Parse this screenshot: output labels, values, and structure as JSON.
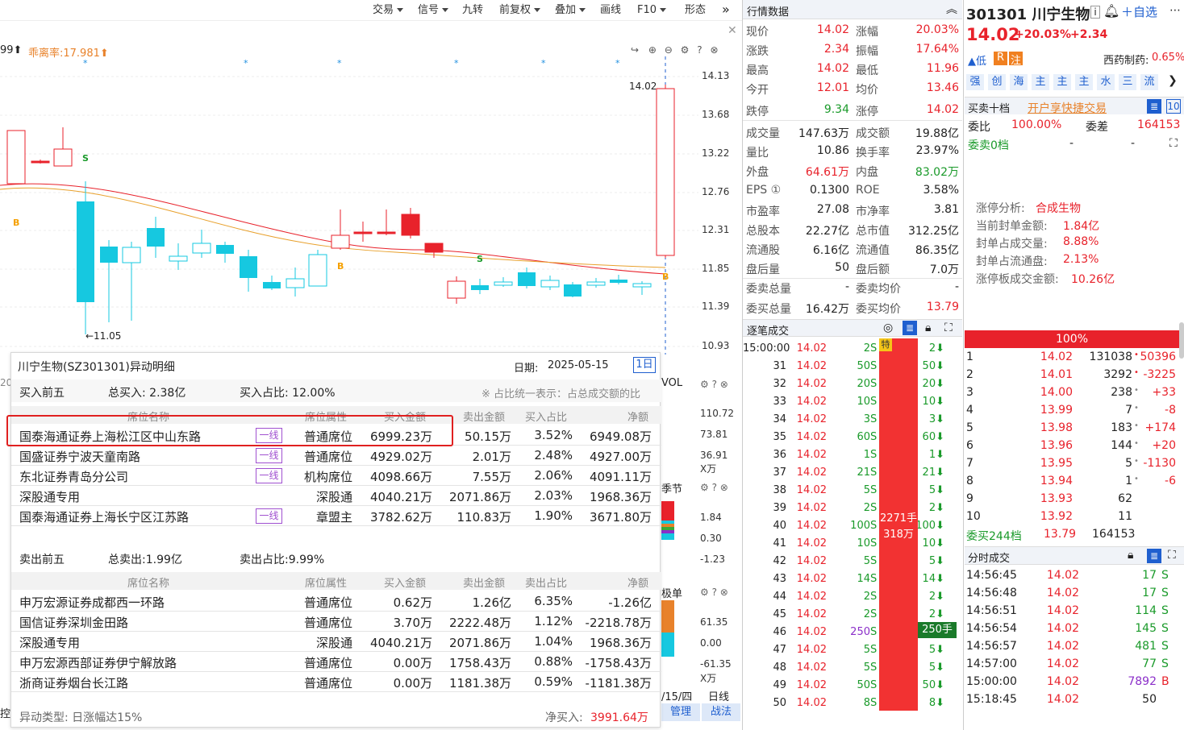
{
  "toolbar": {
    "items": [
      "交易",
      "信号",
      "九转",
      "前复权",
      "叠加",
      "画线",
      "F10",
      "形态"
    ]
  },
  "chart": {
    "indicator_left": "99⬆",
    "deviation_label": "乖离率:17.981⬆",
    "price_axis": [
      "14.13",
      "13.68",
      "13.22",
      "12.76",
      "12.31",
      "11.85",
      "11.39",
      "10.93"
    ],
    "high_mark": "14.02",
    "low_mark": "←11.05",
    "vol_label": "VOL",
    "vol_axis": [
      "110.72",
      "73.81",
      "36.91",
      "X万"
    ],
    "season_label": "季节",
    "season_axis": [
      "1.84",
      "0.30",
      "-1.23"
    ],
    "order_label": "极单",
    "order_axis": [
      "61.35",
      "0.00",
      "-61.35",
      "X万"
    ],
    "date_label": "/15/四",
    "line_label": "日线",
    "manage_label": "管理",
    "battle_label": "战法",
    "left_edge_label": "控",
    "left_edge_label2": "20"
  },
  "popup": {
    "title": "川宁生物(SZ301301)异动明细",
    "date_label": "日期:",
    "date": "2025-05-15",
    "period": "1日",
    "buy": {
      "title": "买入前五",
      "total": "总买入: 2.38亿",
      "ratio": "买入占比: 12.00%",
      "note": "※ 占比统一表示：占总成交额的比",
      "headers": [
        "席位名称",
        "席位属性",
        "买入金额",
        "卖出金额",
        "买入占比",
        "净额"
      ],
      "rows": [
        {
          "name": "国泰海通证券上海松江区中山东路",
          "tag": "一线",
          "attr": "普通席位",
          "buy": "6999.23万",
          "sell": "50.15万",
          "ratio": "3.52%",
          "net": "6949.08万"
        },
        {
          "name": "国盛证券宁波天童南路",
          "tag": "一线",
          "attr": "普通席位",
          "buy": "4929.02万",
          "sell": "2.01万",
          "ratio": "2.48%",
          "net": "4927.00万"
        },
        {
          "name": "东北证券青岛分公司",
          "tag": "一线",
          "attr": "机构席位",
          "buy": "4098.66万",
          "sell": "7.55万",
          "ratio": "2.06%",
          "net": "4091.11万"
        },
        {
          "name": "深股通专用",
          "tag": "",
          "attr": "深股通",
          "buy": "4040.21万",
          "sell": "2071.86万",
          "ratio": "2.03%",
          "net": "1968.36万"
        },
        {
          "name": "国泰海通证券上海长宁区江苏路",
          "tag": "一线",
          "attr": "章盟主",
          "buy": "3782.62万",
          "sell": "110.83万",
          "ratio": "1.90%",
          "net": "3671.80万"
        }
      ]
    },
    "sell": {
      "title": "卖出前五",
      "total": "总卖出:1.99亿",
      "ratio": "卖出占比:9.99%",
      "headers": [
        "席位名称",
        "席位属性",
        "买入金额",
        "卖出金额",
        "卖出占比",
        "净额"
      ],
      "rows": [
        {
          "name": "申万宏源证券成都西一环路",
          "attr": "普通席位",
          "buy": "0.62万",
          "sell": "1.26亿",
          "ratio": "6.35%",
          "net": "-1.26亿"
        },
        {
          "name": "国信证券深圳金田路",
          "attr": "普通席位",
          "buy": "3.70万",
          "sell": "2222.48万",
          "ratio": "1.12%",
          "net": "-2218.78万"
        },
        {
          "name": "深股通专用",
          "attr": "深股通",
          "buy": "4040.21万",
          "sell": "2071.86万",
          "ratio": "1.04%",
          "net": "1968.36万"
        },
        {
          "name": "申万宏源西部证券伊宁解放路",
          "attr": "普通席位",
          "buy": "0.00万",
          "sell": "1758.43万",
          "ratio": "0.88%",
          "net": "-1758.43万"
        },
        {
          "name": "浙商证券烟台长江路",
          "attr": "普通席位",
          "buy": "0.00万",
          "sell": "1181.38万",
          "ratio": "0.59%",
          "net": "-1181.38万"
        }
      ]
    },
    "footer": {
      "type": "异动类型: 日涨幅达15%",
      "net_label": "净买入:",
      "net_value": "3991.64万"
    }
  },
  "quote": {
    "title": "行情数据",
    "rows": [
      [
        "现价",
        "14.02",
        "涨幅",
        "20.03%"
      ],
      [
        "涨跌",
        "2.34",
        "振幅",
        "17.64%"
      ],
      [
        "最高",
        "14.02",
        "最低",
        "11.96"
      ],
      [
        "今开",
        "12.01",
        "均价",
        "13.46"
      ],
      [
        "跌停",
        "9.34",
        "涨停",
        "14.02"
      ],
      [
        "成交量",
        "147.63万",
        "成交额",
        "19.88亿"
      ],
      [
        "量比",
        "10.86",
        "换手率",
        "23.97%"
      ],
      [
        "外盘",
        "64.61万",
        "内盘",
        "83.02万"
      ],
      [
        "EPS ①",
        "0.1300",
        "ROE",
        "3.58%"
      ],
      [
        "市盈率",
        "27.08",
        "市净率",
        "3.81"
      ],
      [
        "总股本",
        "22.27亿",
        "总市值",
        "312.25亿"
      ],
      [
        "流通股",
        "6.16亿",
        "流通值",
        "86.35亿"
      ],
      [
        "盘后量",
        "50",
        "盘后额",
        "7.0万"
      ],
      [
        "委卖总量",
        "-",
        "委卖均价",
        "-"
      ],
      [
        "委买总量",
        "16.42万",
        "委买均价",
        "13.79"
      ]
    ]
  },
  "ticks": {
    "title": "逐笔成交",
    "rows": [
      [
        "15:00:00",
        "14.02",
        "2",
        "S",
        "特",
        "2"
      ],
      [
        "31",
        "14.02",
        "50",
        "S",
        "",
        "50"
      ],
      [
        "32",
        "14.02",
        "20",
        "S",
        "",
        "20"
      ],
      [
        "33",
        "14.02",
        "10",
        "S",
        "",
        "10"
      ],
      [
        "34",
        "14.02",
        "3",
        "S",
        "",
        "3"
      ],
      [
        "35",
        "14.02",
        "60",
        "S",
        "",
        "60"
      ],
      [
        "36",
        "14.02",
        "1",
        "S",
        "",
        "1"
      ],
      [
        "37",
        "14.02",
        "21",
        "S",
        "",
        "21"
      ],
      [
        "38",
        "14.02",
        "5",
        "S",
        "",
        "5"
      ],
      [
        "39",
        "14.02",
        "2",
        "S",
        "",
        "2"
      ],
      [
        "40",
        "14.02",
        "100",
        "S",
        "",
        "100"
      ],
      [
        "41",
        "14.02",
        "10",
        "S",
        "",
        "10"
      ],
      [
        "42",
        "14.02",
        "5",
        "S",
        "",
        "5"
      ],
      [
        "43",
        "14.02",
        "14",
        "S",
        "",
        "14"
      ],
      [
        "44",
        "14.02",
        "2",
        "S",
        "",
        "2"
      ],
      [
        "45",
        "14.02",
        "2",
        "S",
        "",
        "2"
      ],
      [
        "46",
        "14.02",
        "250",
        "S",
        "",
        "250"
      ],
      [
        "47",
        "14.02",
        "5",
        "S",
        "",
        "5"
      ],
      [
        "48",
        "14.02",
        "5",
        "S",
        "",
        "5"
      ],
      [
        "49",
        "14.02",
        "50",
        "S",
        "",
        "50"
      ],
      [
        "50",
        "14.02",
        "8",
        "S",
        "",
        "8"
      ]
    ],
    "big_label": "2271手",
    "big_amount": "318万",
    "tag_250": "250手"
  },
  "stock": {
    "code": "301301",
    "name": "川宁生物",
    "price": "14.02",
    "pct": "+20.03%",
    "chg": "+2.34",
    "self_select": "自选",
    "low_tag": "低",
    "tag_r": "R",
    "tag_zhu": "注",
    "sector": "西药制药:",
    "sector_pct": "0.65%",
    "chips": [
      "强",
      "创",
      "海",
      "主",
      "主",
      "主",
      "水",
      "三",
      "流"
    ],
    "order10": "买卖十档",
    "open_account": "开户享快捷交易",
    "ten": "10",
    "weibi_label": "委比",
    "weibi": "100.00%",
    "weicha_label": "委差",
    "weicha": "164153",
    "sell0": "委卖0档",
    "dash1": "-",
    "dash2": "-",
    "limit_title": "涨停分析:",
    "limit_val": "合成生物",
    "limit_rows": [
      [
        "当前封单金额:",
        "1.84亿"
      ],
      [
        "封单占成交量:",
        "8.88%"
      ],
      [
        "封单占流通盘:",
        "2.13%"
      ],
      [
        "涨停板成交金额:",
        "10.26亿"
      ]
    ],
    "pct100": "100%",
    "bids": [
      [
        "1",
        "14.02",
        "131038",
        "-",
        "50396"
      ],
      [
        "2",
        "14.01",
        "3292",
        "-",
        "-3225"
      ],
      [
        "3",
        "14.00",
        "238",
        "",
        "+33"
      ],
      [
        "4",
        "13.99",
        "7",
        "",
        "-8"
      ],
      [
        "5",
        "13.98",
        "183",
        "",
        "+174"
      ],
      [
        "6",
        "13.96",
        "144",
        "",
        "+20"
      ],
      [
        "7",
        "13.95",
        "5",
        "",
        "-1130"
      ],
      [
        "8",
        "13.94",
        "1",
        "",
        "-6"
      ],
      [
        "9",
        "13.93",
        "62",
        "",
        ""
      ],
      [
        "10",
        "13.92",
        "11",
        "",
        ""
      ]
    ],
    "bid_total_label": "委买244档",
    "bid_total_price": "13.79",
    "bid_total_vol": "164153",
    "fenshi_title": "分时成交",
    "fenshi": [
      [
        "14:56:45",
        "14.02",
        "17",
        "S"
      ],
      [
        "14:56:48",
        "14.02",
        "17",
        "S"
      ],
      [
        "14:56:51",
        "14.02",
        "114",
        "S"
      ],
      [
        "14:56:54",
        "14.02",
        "145",
        "S"
      ],
      [
        "14:56:57",
        "14.02",
        "481",
        "S"
      ],
      [
        "14:57:00",
        "14.02",
        "77",
        "S"
      ],
      [
        "15:00:00",
        "14.02",
        "7892",
        "B"
      ],
      [
        "15:18:45",
        "14.02",
        "50",
        ""
      ]
    ]
  },
  "colors": {
    "red": "#e8222b",
    "green": "#1a9a2a",
    "cyan": "#16c8e0",
    "blue": "#1f5fcf",
    "highlight_box": "#e02020"
  }
}
